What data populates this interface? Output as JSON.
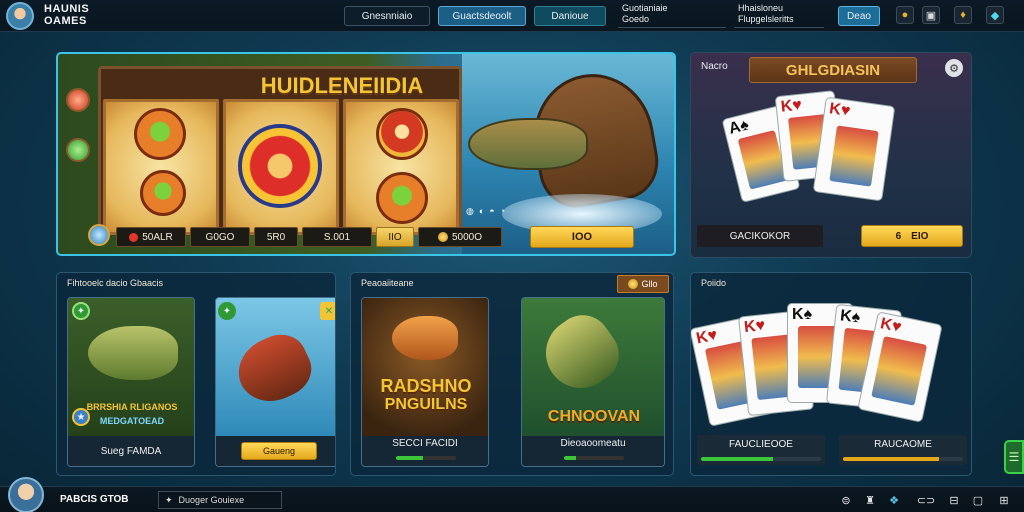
{
  "header": {
    "brand_line1": "HAUNIS",
    "brand_line2": "OAMES",
    "search_label": "Gnesnniaio",
    "primary_button": "Guactsdeoolt",
    "secondary_button": "Danioue",
    "info1_line1": "Guotianiaie",
    "info1_line2": "Goedo",
    "info2_line1": "Hhaisloneu",
    "info2_line2": "Flupgelsleritts",
    "account_button": "Deao"
  },
  "slot_panel": {
    "title": "HUIDLENEIIDIA",
    "bet_label": "50ALR",
    "bet_value": "G0GO",
    "lines_value": "5R0",
    "total_value": "S.001",
    "multiplier": "IIO",
    "coins_value": "5000O",
    "spin_label": "IOO",
    "mini_icons": [
      "◍",
      "◐",
      "◓",
      "◔"
    ]
  },
  "card_panel": {
    "tag": "Nacro",
    "title": "GHLGDIASIN",
    "close_icon": "⚙",
    "label": "GACIKOKOR",
    "gold_prefix": "6",
    "gold_value": "EIO",
    "cards": [
      {
        "rank": "A",
        "suit": "♠"
      },
      {
        "rank": "K",
        "suit": "♥"
      },
      {
        "rank": "K",
        "suit": "♥"
      }
    ]
  },
  "sections": {
    "left": {
      "title": "Fihtooelc dacio Gbaacis",
      "tile1_text_top": "BRRSHIA RLIGANOS",
      "tile1_text_bottom": "MEDGATOEAD",
      "tile1_foot": "Sueg FAMDA",
      "tile2_foot": "Gaueng"
    },
    "mid": {
      "title": "Peaoaiiteane",
      "badge": "Gllo",
      "tile1_art_text1": "RADSHNO",
      "tile1_art_text2": "PNGUILNS",
      "tile1_foot": "SECCI FACIDI",
      "tile2_art_text": "CHNOOVAN",
      "tile2_foot": "Dieoaoomeatu",
      "tile1_progress": 0.45,
      "tile2_progress": 0.2
    },
    "right": {
      "title": "Poiido",
      "foot1": "FAUCLIEOOE",
      "foot2": "RAUCAOME",
      "bar1": 0.6,
      "bar2": 0.8,
      "cards": [
        {
          "rank": "K",
          "suit": "♥",
          "color": "red"
        },
        {
          "rank": "K",
          "suit": "♥",
          "color": "red"
        },
        {
          "rank": "K",
          "suit": "♠",
          "color": "black"
        },
        {
          "rank": "K",
          "suit": "♠",
          "color": "black"
        },
        {
          "rank": "K",
          "suit": "♥",
          "color": "red"
        }
      ]
    }
  },
  "footer": {
    "username": "PABCIS GTOB",
    "search_text": "Duoger Gouiexe",
    "icons": [
      "⊜",
      "♜",
      "❖",
      "⊂⊃",
      "⊟",
      "▢",
      "⊞"
    ]
  },
  "colors": {
    "accent": "#3dc3e6",
    "gold": "#f4c534",
    "green": "#3ec63a"
  }
}
